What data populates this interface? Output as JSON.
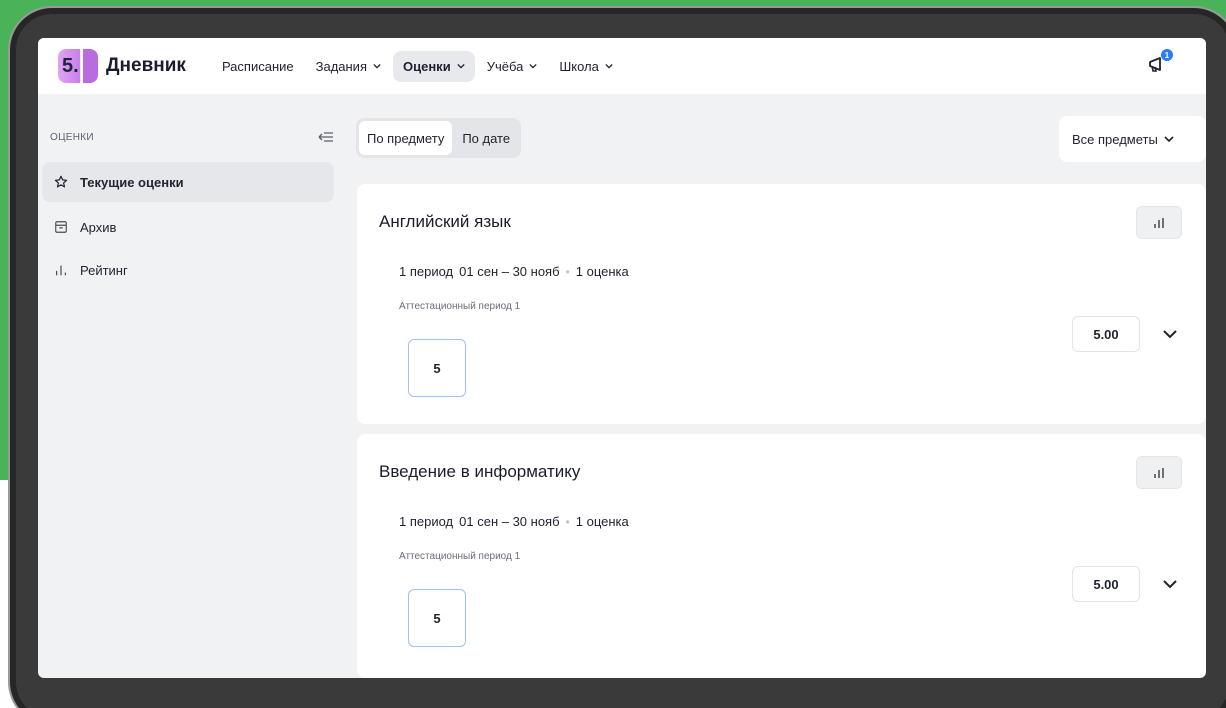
{
  "app": {
    "logo_number": "5.",
    "name": "Дневник"
  },
  "nav": {
    "items": [
      {
        "label": "Расписание",
        "dropdown": false,
        "active": false
      },
      {
        "label": "Задания",
        "dropdown": true,
        "active": false
      },
      {
        "label": "Оценки",
        "dropdown": true,
        "active": true
      },
      {
        "label": "Учёба",
        "dropdown": true,
        "active": false
      },
      {
        "label": "Школа",
        "dropdown": true,
        "active": false
      }
    ],
    "notifications_count": "1"
  },
  "sidebar": {
    "heading": "ОЦЕНКИ",
    "items": [
      {
        "label": "Текущие оценки",
        "icon": "star-icon",
        "active": true
      },
      {
        "label": "Архив",
        "icon": "archive-icon",
        "active": false
      },
      {
        "label": "Рейтинг",
        "icon": "rating-bars-icon",
        "active": false
      }
    ]
  },
  "main": {
    "tabs": [
      {
        "label": "По предмету",
        "active": true
      },
      {
        "label": "По дате",
        "active": false
      }
    ],
    "subject_filter": "Все предметы",
    "subjects": [
      {
        "title": "Английский язык",
        "period": "1 период",
        "dates": "01 сен – 30 нояб",
        "count": "1 оценка",
        "period_name": "Аттестационный период 1",
        "grades": [
          "5"
        ],
        "average": "5.00"
      },
      {
        "title": "Введение в информатику",
        "period": "1 период",
        "dates": "01 сен – 30 нояб",
        "count": "1 оценка",
        "period_name": "Аттестационный период 1",
        "grades": [
          "5"
        ],
        "average": "5.00"
      }
    ]
  },
  "colors": {
    "background_green": "#4ab35a",
    "device_frame": "#3a3a3a",
    "screen_bg": "#f1f2f4",
    "grade_border": "#9fc2ee",
    "badge_blue": "#2b7cf6"
  }
}
